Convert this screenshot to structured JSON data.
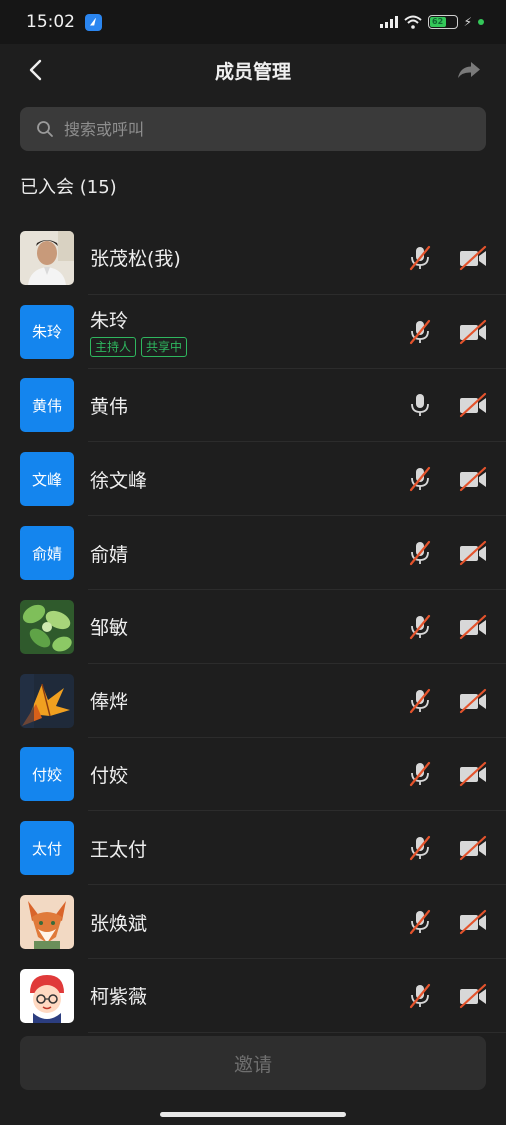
{
  "status_bar": {
    "time": "15:02",
    "battery_level": "62",
    "battery_percent": 62
  },
  "nav": {
    "title": "成员管理"
  },
  "search": {
    "placeholder": "搜索或呼叫"
  },
  "section": {
    "heading": "已入会 (15)"
  },
  "members": [
    {
      "name": "张茂松(我)",
      "avatar_type": "photo",
      "avatar_icon": "man-photo",
      "avatar_text": "",
      "tags": [],
      "mic": "muted",
      "camera": "off"
    },
    {
      "name": "朱玲",
      "avatar_type": "text",
      "avatar_text": "朱玲",
      "tags": [
        "主持人",
        "共享中"
      ],
      "mic": "muted",
      "camera": "off"
    },
    {
      "name": "黄伟",
      "avatar_type": "text",
      "avatar_text": "黄伟",
      "tags": [],
      "mic": "on",
      "camera": "off"
    },
    {
      "name": "徐文峰",
      "avatar_type": "text",
      "avatar_text": "文峰",
      "tags": [],
      "mic": "muted",
      "camera": "off"
    },
    {
      "name": "俞婧",
      "avatar_type": "text",
      "avatar_text": "俞婧",
      "tags": [],
      "mic": "muted",
      "camera": "off"
    },
    {
      "name": "邹敏",
      "avatar_type": "photo",
      "avatar_icon": "leaves-photo",
      "avatar_text": "",
      "tags": [],
      "mic": "muted",
      "camera": "off"
    },
    {
      "name": "俸烨",
      "avatar_type": "photo",
      "avatar_icon": "autumn-leaf-photo",
      "avatar_text": "",
      "tags": [],
      "mic": "muted",
      "camera": "off"
    },
    {
      "name": "付姣",
      "avatar_type": "text",
      "avatar_text": "付姣",
      "tags": [],
      "mic": "muted",
      "camera": "off"
    },
    {
      "name": "王太付",
      "avatar_type": "text",
      "avatar_text": "太付",
      "tags": [],
      "mic": "muted",
      "camera": "off"
    },
    {
      "name": "张焕斌",
      "avatar_type": "photo",
      "avatar_icon": "fox-cartoon",
      "avatar_text": "",
      "tags": [],
      "mic": "muted",
      "camera": "off"
    },
    {
      "name": "柯紫薇",
      "avatar_type": "photo",
      "avatar_icon": "girl-cartoon",
      "avatar_text": "",
      "tags": [],
      "mic": "muted",
      "camera": "off"
    }
  ],
  "invite": {
    "label": "邀请"
  },
  "colors": {
    "accent": "#1485ee",
    "muted_slash": "#e4532c",
    "tag_green": "#2fb75f",
    "background": "#1e1e1e"
  }
}
